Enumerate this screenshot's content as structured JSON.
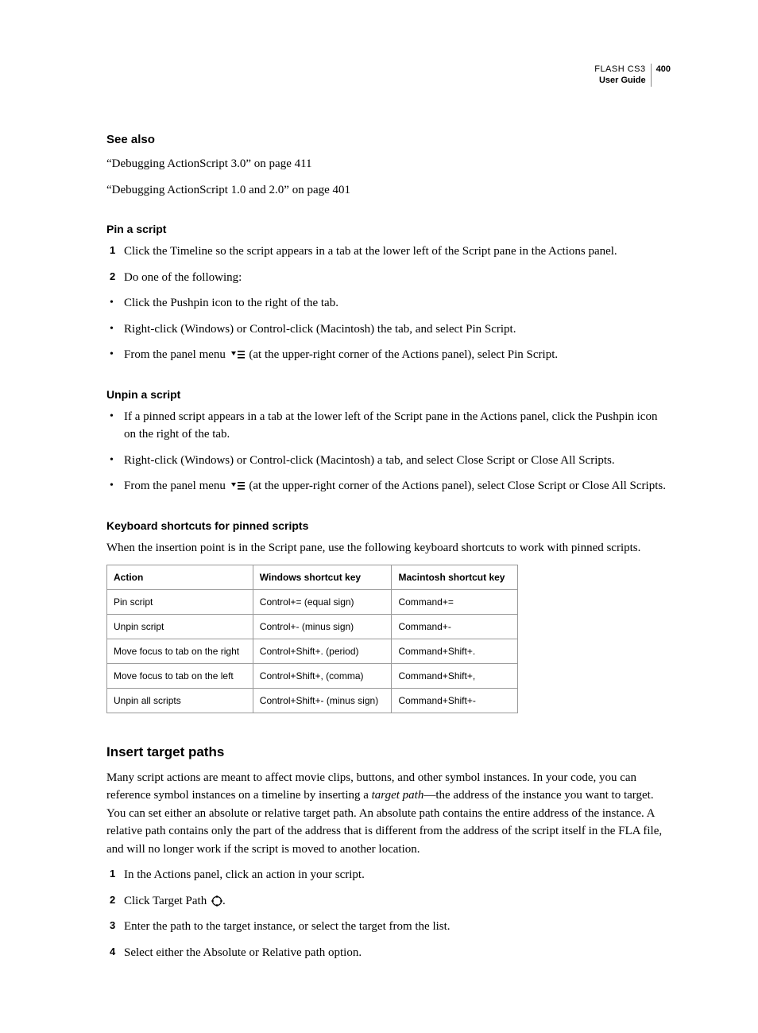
{
  "header": {
    "product": "FLASH CS3",
    "guide": "User Guide",
    "page": "400"
  },
  "see_also": {
    "heading": "See also",
    "links": [
      "“Debugging ActionScript 3.0” on page 411",
      "“Debugging ActionScript 1.0 and 2.0” on page 401"
    ]
  },
  "pin_a_script": {
    "heading": "Pin a script",
    "step1": "Click the Timeline so the script appears in a tab at the lower left of the Script pane in the Actions panel.",
    "step2": "Do one of the following:",
    "bullets": {
      "b1": "Click the Pushpin icon to the right of the tab.",
      "b2": "Right-click (Windows) or Control-click (Macintosh) the tab, and select Pin Script.",
      "b3_pre": "From the panel menu ",
      "b3_post": " (at the upper-right corner of the Actions panel), select Pin Script."
    }
  },
  "unpin_a_script": {
    "heading": "Unpin a script",
    "bullets": {
      "b1": "If a pinned script appears in a tab at the lower left of the Script pane in the Actions panel, click the Pushpin icon on the right of the tab.",
      "b2": "Right-click (Windows) or Control-click (Macintosh) a tab, and select Close Script or Close All Scripts.",
      "b3_pre": "From the panel menu ",
      "b3_post": " (at the upper-right corner of the Actions panel), select Close Script or Close All Scripts."
    }
  },
  "shortcuts": {
    "heading": "Keyboard shortcuts for pinned scripts",
    "intro": "When the insertion point is in the Script pane, use the following keyboard shortcuts to work with pinned scripts.",
    "cols": {
      "c1": "Action",
      "c2": "Windows shortcut key",
      "c3": "Macintosh shortcut key"
    },
    "rows": [
      {
        "c1": "Pin script",
        "c2": "Control+= (equal sign)",
        "c3": "Command+="
      },
      {
        "c1": "Unpin script",
        "c2": "Control+- (minus sign)",
        "c3": "Command+-"
      },
      {
        "c1": "Move focus to tab on the right",
        "c2": "Control+Shift+. (period)",
        "c3": "Command+Shift+."
      },
      {
        "c1": "Move focus to tab on the left",
        "c2": "Control+Shift+, (comma)",
        "c3": "Command+Shift+,"
      },
      {
        "c1": "Unpin all scripts",
        "c2": "Control+Shift+- (minus sign)",
        "c3": "Command+Shift+-"
      }
    ]
  },
  "insert_target_paths": {
    "heading": "Insert target paths",
    "para_pre": "Many script actions are meant to affect movie clips, buttons, and other symbol instances. In your code, you can reference symbol instances on a timeline by inserting a ",
    "para_em": "target path",
    "para_post": "—the address of the instance you want to target. You can set either an absolute or relative target path. An absolute path contains the entire address of the instance. A relative path contains only the part of the address that is different from the address of the script itself in the FLA file, and will no longer work if the script is moved to another location.",
    "steps": {
      "s1": "In the Actions panel, click an action in your script.",
      "s2_pre": "Click Target Path ",
      "s2_post": ".",
      "s3": "Enter the path to the target instance, or select the target from the list.",
      "s4": "Select either the Absolute or Relative path option."
    }
  }
}
